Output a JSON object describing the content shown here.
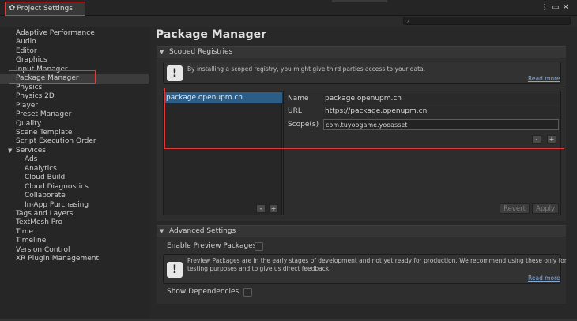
{
  "window": {
    "tab_title": "Project Settings",
    "icons": [
      "more-icon",
      "maximize-icon",
      "close-icon"
    ]
  },
  "search": {
    "placeholder": ""
  },
  "sidebar": {
    "items": [
      {
        "label": "Adaptive Performance",
        "indent": 0
      },
      {
        "label": "Audio",
        "indent": 0
      },
      {
        "label": "Editor",
        "indent": 0
      },
      {
        "label": "Graphics",
        "indent": 0
      },
      {
        "label": "Input Manager",
        "indent": 0
      },
      {
        "label": "Package Manager",
        "indent": 0,
        "selected": true
      },
      {
        "label": "Physics",
        "indent": 0
      },
      {
        "label": "Physics 2D",
        "indent": 0
      },
      {
        "label": "Player",
        "indent": 0
      },
      {
        "label": "Preset Manager",
        "indent": 0
      },
      {
        "label": "Quality",
        "indent": 0
      },
      {
        "label": "Scene Template",
        "indent": 0
      },
      {
        "label": "Script Execution Order",
        "indent": 0
      },
      {
        "label": "Services",
        "indent": 0,
        "expanded": true
      },
      {
        "label": "Ads",
        "indent": 1
      },
      {
        "label": "Analytics",
        "indent": 1
      },
      {
        "label": "Cloud Build",
        "indent": 1
      },
      {
        "label": "Cloud Diagnostics",
        "indent": 1
      },
      {
        "label": "Collaborate",
        "indent": 1
      },
      {
        "label": "In-App Purchasing",
        "indent": 1
      },
      {
        "label": "Tags and Layers",
        "indent": 0
      },
      {
        "label": "TextMesh Pro",
        "indent": 0
      },
      {
        "label": "Time",
        "indent": 0
      },
      {
        "label": "Timeline",
        "indent": 0
      },
      {
        "label": "Version Control",
        "indent": 0
      },
      {
        "label": "XR Plugin Management",
        "indent": 0
      }
    ]
  },
  "main": {
    "title": "Package Manager",
    "scoped": {
      "header": "Scoped Registries",
      "info": "By installing a scoped registry, you might give third parties access to your data.",
      "read_more": "Read more",
      "registries": [
        "package.openupm.cn"
      ],
      "name_label": "Name",
      "name_value": "package.openupm.cn",
      "url_label": "URL",
      "url_value": "https://package.openupm.cn",
      "scope_label": "Scope(s)",
      "scope_value": "com.tuyoogame.yooasset",
      "minus": "-",
      "plus": "+",
      "revert": "Revert",
      "apply": "Apply"
    },
    "advanced": {
      "header": "Advanced Settings",
      "preview_label": "Enable Preview Packages",
      "preview_checked": false,
      "info_line1": "Preview Packages are in the early stages of development and not yet ready for production. We recommend using these only for",
      "info_line2": "testing purposes and to give us direct feedback.",
      "read_more": "Read more",
      "deps_label": "Show Dependencies",
      "deps_checked": false
    }
  },
  "colors": {
    "highlight_box": "#e03a3a",
    "selection": "#2c5d87",
    "link": "#7ea9d7"
  }
}
